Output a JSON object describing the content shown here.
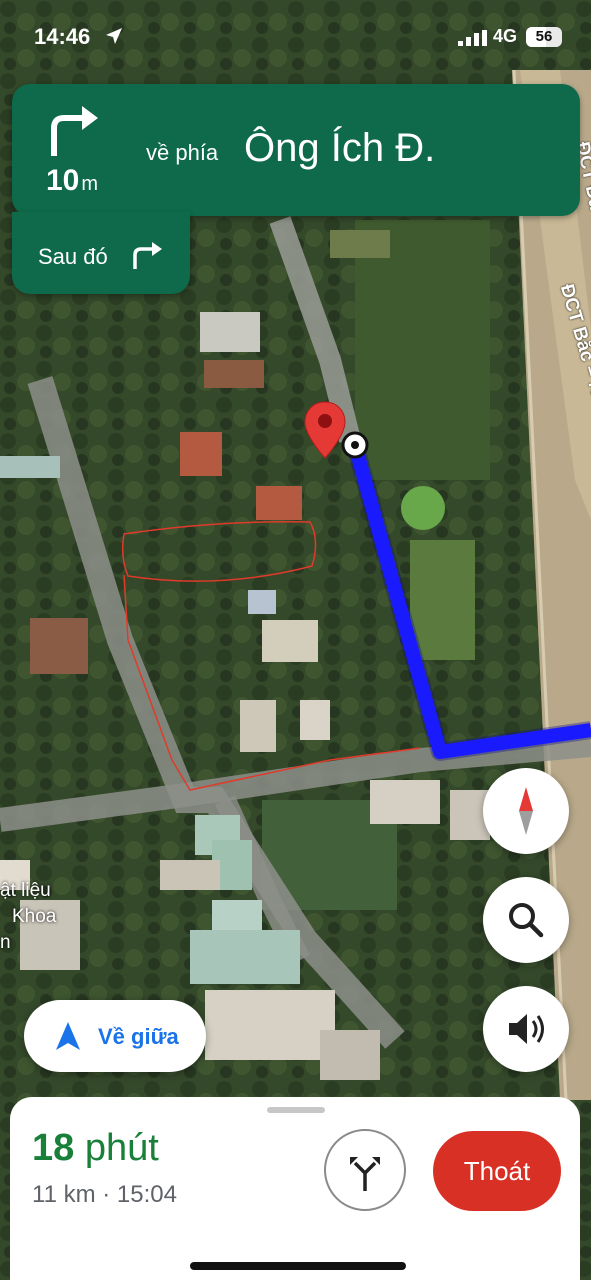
{
  "status_bar": {
    "time": "14:46",
    "network": "4G",
    "battery": "56"
  },
  "navigation": {
    "distance_value": "10",
    "distance_unit": "m",
    "toward_label": "về phía",
    "street_name": "Ông Ích Đ.",
    "then_label": "Sau đó",
    "turn_icon": "turn-right-icon",
    "next_turn_icon": "turn-right-icon"
  },
  "map": {
    "road_label_1": "ĐCT Bắc – Nam Phía Đông",
    "road_label_2": "ĐCT Đà Nẵng",
    "poi_lines": [
      "ật liệu",
      "Khoa",
      "n"
    ],
    "route_color": "#1a1aff",
    "pin_color": "#e53935"
  },
  "controls": {
    "compass_icon": "compass-icon",
    "search_icon": "search-icon",
    "sound_icon": "volume-icon",
    "recenter_label": "Về giữa",
    "recenter_icon": "navigation-arrow-icon"
  },
  "trip": {
    "duration_value": "18",
    "duration_unit": "phút",
    "summary": "11 km · 15:04",
    "routes_icon": "alternate-routes-icon",
    "exit_label": "Thoát",
    "exit_color": "#d93025"
  },
  "colors": {
    "banner": "#0e6a4a",
    "accent": "#188038"
  }
}
